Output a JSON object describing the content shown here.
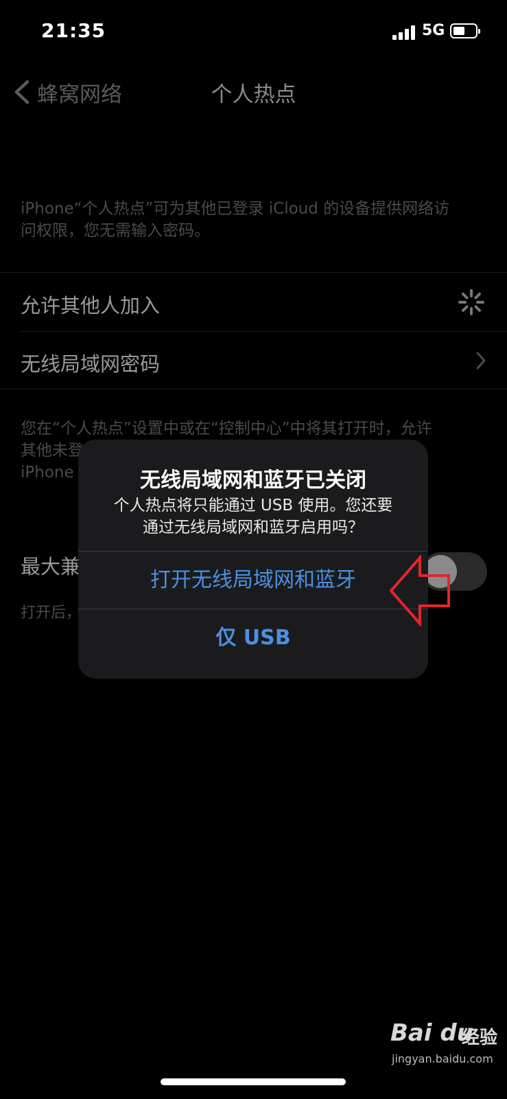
{
  "status_bar": {
    "time": "21:35",
    "network": "5G",
    "battery_level": 0.5
  },
  "nav": {
    "back_label": "蜂窝网络",
    "title": "个人热点"
  },
  "settings": {
    "description_top_line1": "iPhone“个人热点”可为其他已登录 iCloud 的设备提供网络访",
    "description_top_line2": "问权限，您无需输入密码。",
    "allow_others_label": "允许其他人加入",
    "wifi_password_label": "无线局域网密码",
    "description_mid_line1": "您在“个人热点”设置中或在“控制中心”中将其打开时，允许",
    "description_mid_line2": "其他未登",
    "description_mid_line3": "iPhone",
    "max_compat_label": "最大兼",
    "max_compat_note": "打开后，"
  },
  "alert": {
    "title": "无线局域网和蓝牙已关闭",
    "message_line1": "个人热点将只能通过 USB 使用。您还要",
    "message_line2": "通过无线局域网和蓝牙启用吗？",
    "primary_button": "打开无线局域网和蓝牙",
    "secondary_button": "仅 USB"
  },
  "colors": {
    "alert_button": "#4a90e2",
    "annotation_arrow": "#e0262c"
  },
  "watermark": {
    "logo": "Bai du",
    "text": "经验",
    "url": "jingyan.baidu.com"
  }
}
